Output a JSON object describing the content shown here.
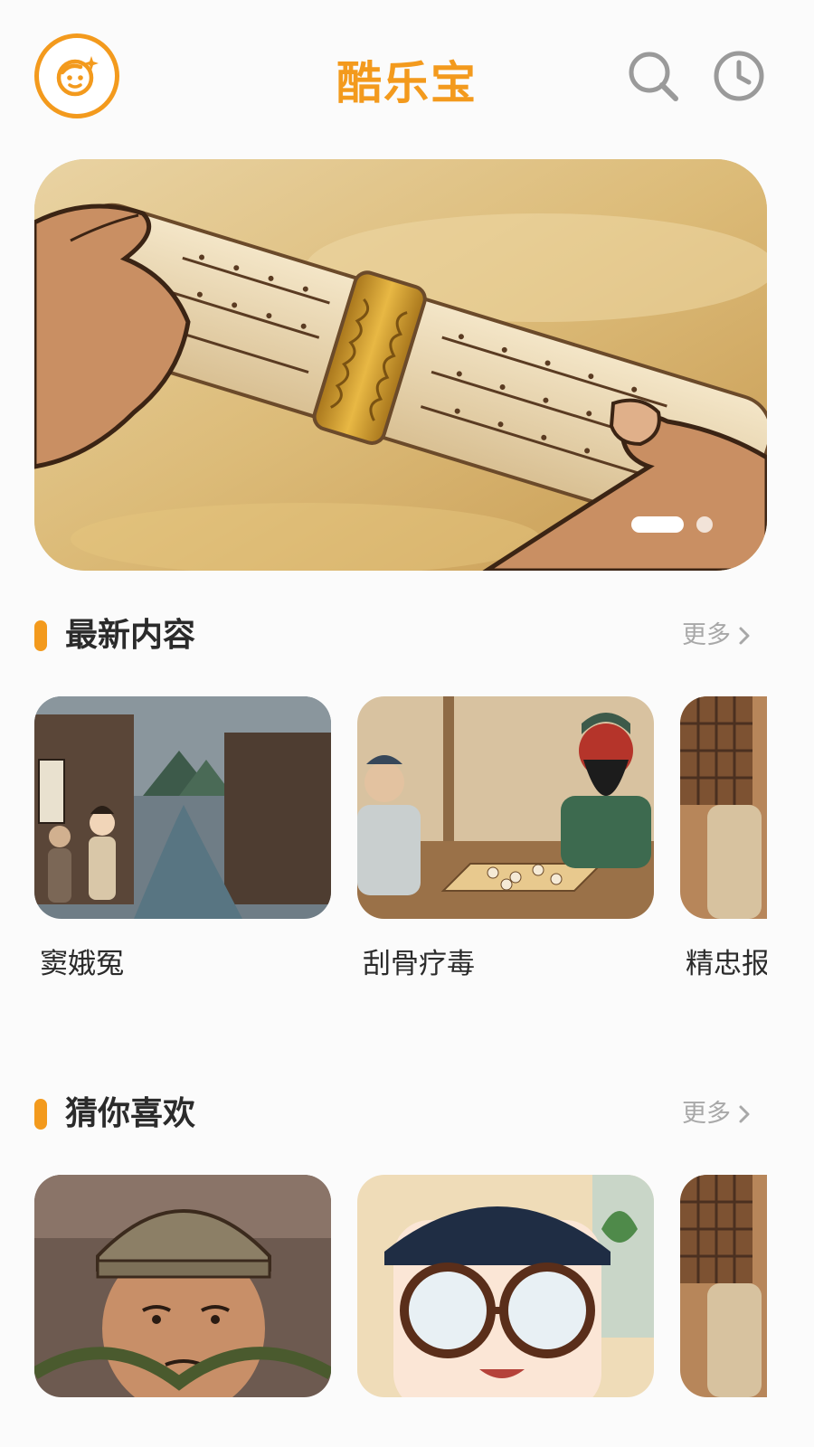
{
  "header": {
    "title": "酷乐宝",
    "avatar_icon": "kid-face-icon",
    "search_icon": "search-icon",
    "history_icon": "clock-icon",
    "accent_color": "#f39a1d"
  },
  "banner": {
    "icon": "scroll-image",
    "slide_count": 2,
    "active_slide": 1
  },
  "sections": [
    {
      "title": "最新内容",
      "more_label": "更多",
      "items": [
        {
          "title": "窦娥冤",
          "image": "ancient-street-scene"
        },
        {
          "title": "刮骨疗毒",
          "image": "guanyu-chess-scene"
        },
        {
          "title": "精忠报",
          "image": "window-scene"
        }
      ]
    },
    {
      "title": "猜你喜欢",
      "more_label": "更多",
      "items": [
        {
          "title": "",
          "image": "bound-man-scene"
        },
        {
          "title": "",
          "image": "glasses-boy-scene"
        },
        {
          "title": "",
          "image": "window-scene"
        }
      ]
    }
  ]
}
